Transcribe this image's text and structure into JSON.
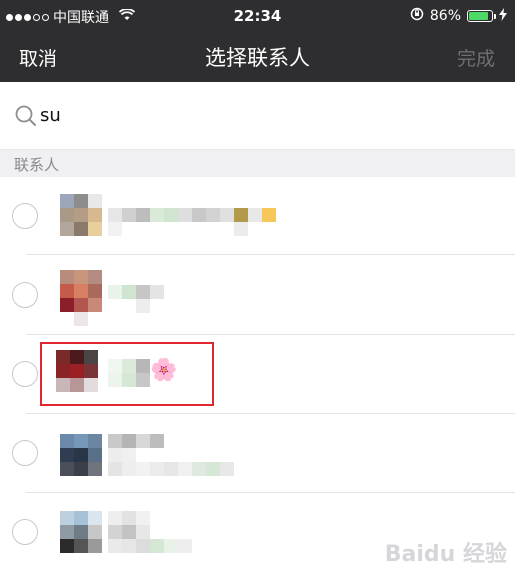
{
  "status_bar": {
    "carrier": "中国联通",
    "time": "22:34",
    "battery_percent": "86%",
    "battery_level": 0.86,
    "signal_icon": "signal-dots-icon",
    "wifi_icon": "wifi-icon",
    "rotation_lock_icon": "rotation-lock-icon",
    "charging_icon": "charging-bolt-icon"
  },
  "nav": {
    "cancel_label": "取消",
    "title": "选择联系人",
    "done_label": "完成"
  },
  "search": {
    "value": "su",
    "icon": "search-icon"
  },
  "section": {
    "header": "联系人"
  },
  "contacts": [
    {
      "selected": false,
      "name_obscured": true
    },
    {
      "selected": false,
      "name_obscured": true
    },
    {
      "selected": false,
      "name_obscured": true,
      "highlighted": true,
      "emoji": "🌸"
    },
    {
      "selected": false,
      "name_obscured": true
    },
    {
      "selected": false,
      "name_obscured": true
    }
  ],
  "colors": {
    "bar_background": "#2e2e30",
    "highlight_border": "#e0262e",
    "done_disabled": "#6f6f72"
  },
  "watermark": "Baidu 经验"
}
